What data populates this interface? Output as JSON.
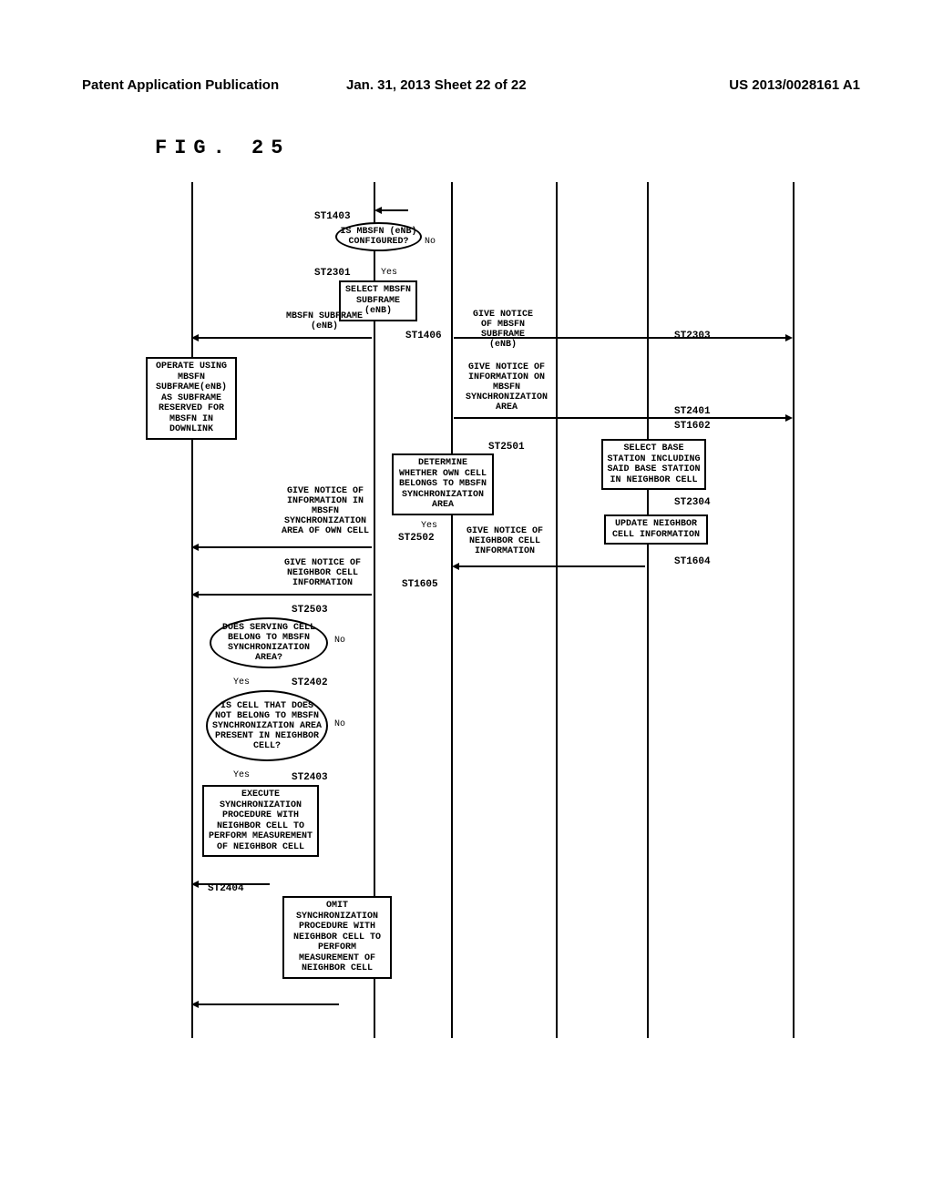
{
  "header": {
    "left": "Patent Application Publication",
    "center": "Jan. 31, 2013  Sheet 22 of 22",
    "right": "US 2013/0028161 A1"
  },
  "figure_label": "FIG. 25",
  "steps": {
    "st1403": "ST1403",
    "st2301": "ST2301",
    "st1406": "ST1406",
    "st2303": "ST2303",
    "st2401": "ST2401",
    "st1602": "ST1602",
    "st2304": "ST2304",
    "st1604": "ST1604",
    "st2501": "ST2501",
    "st2502": "ST2502",
    "st1605": "ST1605",
    "st2503": "ST2503",
    "st2402": "ST2402",
    "st2403": "ST2403",
    "st2404": "ST2404"
  },
  "boxes": {
    "mbsfn_config": "IS MBSFN (eNB) CONFIGURED?",
    "select_mbsfn": "SELECT MBSFN SUBFRAME (eNB)",
    "mbsfn_subframe_msg": "MBSFN SUBFRAME (eNB)",
    "give_notice_subframe": "GIVE NOTICE OF MBSFN SUBFRAME (eNB)",
    "operate_using": "OPERATE USING MBSFN SUBFRAME(eNB) AS SUBFRAME RESERVED FOR MBSFN IN DOWNLINK",
    "give_notice_sync_area": "GIVE NOTICE OF INFORMATION ON MBSFN SYNCHRONIZATION AREA",
    "select_base_station": "SELECT BASE STATION INCLUDING SAID BASE STATION IN NEIGHBOR CELL",
    "update_neighbor": "UPDATE NEIGHBOR CELL INFORMATION",
    "determine_own_cell": "DETERMINE WHETHER OWN CELL BELONGS TO MBSFN SYNCHRONIZATION AREA",
    "give_notice_neighbor_msg": "GIVE NOTICE OF NEIGHBOR CELL INFORMATION",
    "give_notice_sync_own": "GIVE NOTICE OF INFORMATION IN MBSFN SYNCHRONIZATION AREA OF OWN CELL",
    "give_notice_neighbor": "GIVE NOTICE OF NEIGHBOR CELL INFORMATION",
    "does_serving_belong": "DOES SERVING CELL BELONG TO MBSFN SYNCHRONIZATION AREA?",
    "is_cell_not_belong": "IS CELL THAT DOES NOT BELONG TO MBSFN SYNCHRONIZATION AREA PRESENT IN NEIGHBOR CELL?",
    "execute_sync": "EXECUTE SYNCHRONIZATION PROCEDURE WITH NEIGHBOR CELL TO PERFORM MEASUREMENT OF NEIGHBOR CELL",
    "omit_sync": "OMIT SYNCHRONIZATION PROCEDURE WITH NEIGHBOR CELL TO PERFORM MEASUREMENT OF NEIGHBOR CELL"
  },
  "labels": {
    "yes": "Yes",
    "no": "No"
  }
}
